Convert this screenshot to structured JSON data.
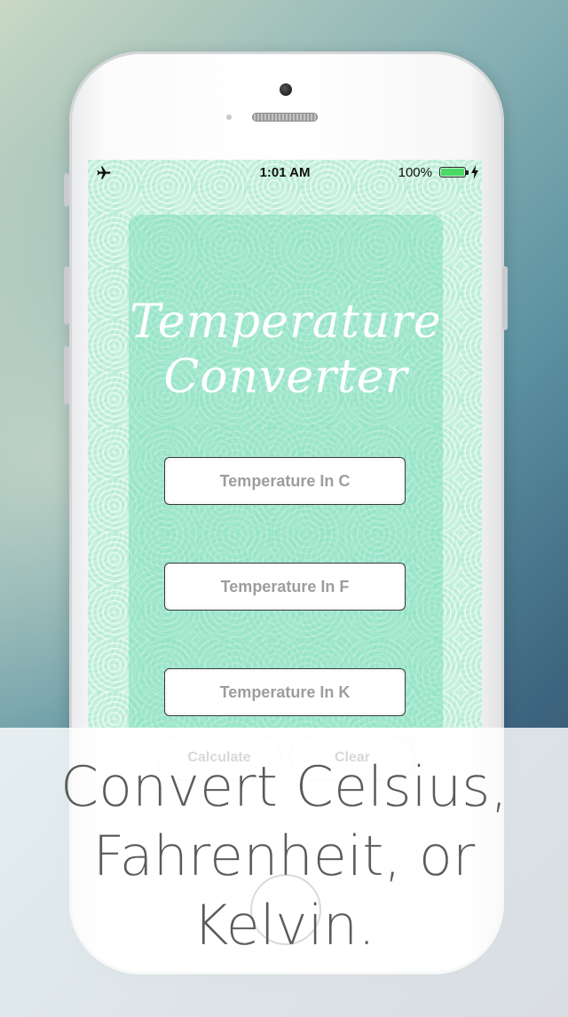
{
  "status_bar": {
    "time": "1:01 AM",
    "battery_percent": "100%",
    "battery_level": 1.0,
    "battery_color": "#4cd964",
    "icons": [
      "airplane-icon",
      "battery-icon",
      "charging-bolt-icon"
    ]
  },
  "app": {
    "title_line1": "Temperature",
    "title_line2": "Converter",
    "fields": [
      {
        "placeholder": "Temperature In C",
        "value": ""
      },
      {
        "placeholder": "Temperature In F",
        "value": ""
      },
      {
        "placeholder": "Temperature In K",
        "value": ""
      }
    ],
    "calculate_label": "Calculate",
    "clear_label": "Clear"
  },
  "caption": {
    "line1": "Convert Celsius,",
    "line2": "Fahrenheit, or",
    "line3": "Kelvin."
  },
  "colors": {
    "screen_bg": "#c7f1de",
    "card_bg": "#8fe3c4",
    "title_text": "#ffffff",
    "caption_text": "#5a5a5a"
  }
}
